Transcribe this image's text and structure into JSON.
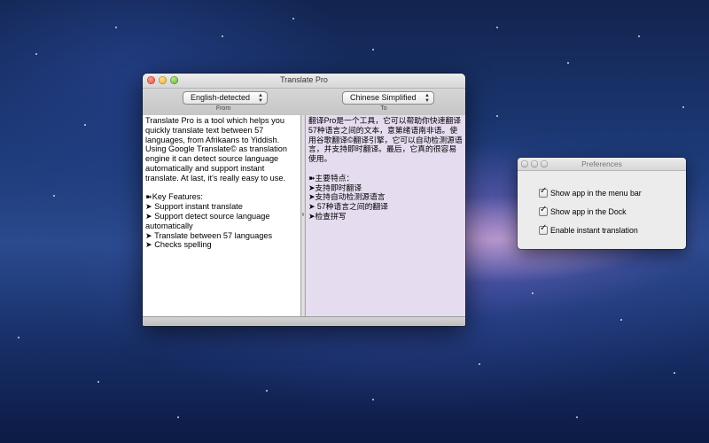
{
  "main_window": {
    "title": "Translate Pro",
    "from": {
      "selected": "English-detected",
      "label": "From"
    },
    "to": {
      "selected": "Chinese Simplified",
      "label": "To"
    },
    "source_text": "Translate Pro is a tool which helps you quickly translate text between 57 languages, from Afrikaans to Yiddish. Using Google Translate© as translation engine it can detect source language automatically and support instant translate. At last, it's really easy to use.\n\n➽Key Features:\n➤ Support instant translate\n➤ Support detect source language automatically\n➤ Translate between 57 languages\n➤ Checks spelling",
    "translated_text": "翻译Pro是一个工具，它可以帮助你快速翻译57种语言之间的文本，意第绪语南非语。使用谷歌翻译©翻译引擎，它可以自动检测源语言，并支持即时翻译。最后，它真的很容易使用。\n\n➽主要特点：\n➤支持即时翻译\n➤支持自动检测源语言\n➤ 57种语言之间的翻译\n➤检查拼写"
  },
  "preferences_window": {
    "title": "Preferences",
    "options": [
      {
        "label": "Show app in the menu bar",
        "checked": true
      },
      {
        "label": "Show app in the Dock",
        "checked": true
      },
      {
        "label": "Enable instant translation",
        "checked": true
      }
    ]
  }
}
